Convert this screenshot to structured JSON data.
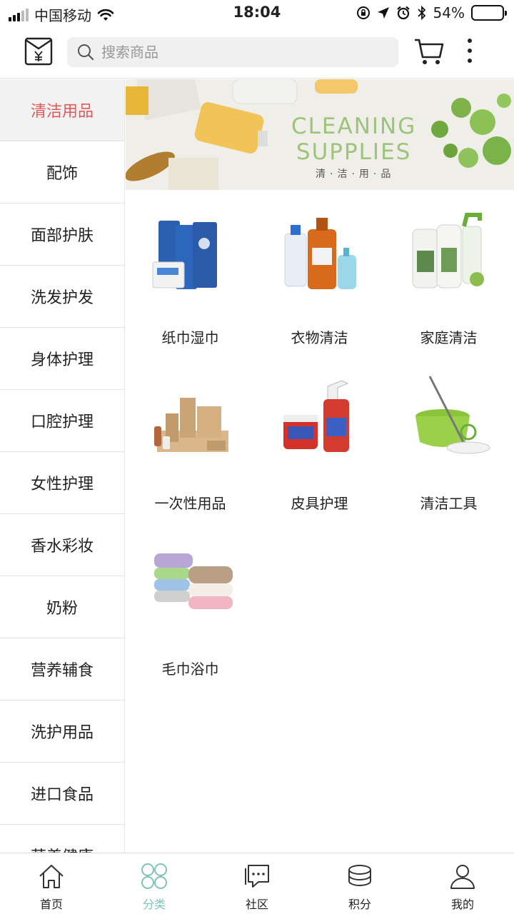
{
  "status_bar": {
    "carrier": "中国移动",
    "time": "18:04",
    "battery": "54%",
    "battery_level": 0.54
  },
  "header": {
    "search_placeholder": "搜索商品"
  },
  "sidebar": {
    "items": [
      {
        "label": "清洁用品",
        "active": true
      },
      {
        "label": "配饰"
      },
      {
        "label": "面部护肤"
      },
      {
        "label": "洗发护发"
      },
      {
        "label": "身体护理"
      },
      {
        "label": "口腔护理"
      },
      {
        "label": "女性护理"
      },
      {
        "label": "香水彩妆"
      },
      {
        "label": "奶粉"
      },
      {
        "label": "营养辅食"
      },
      {
        "label": "洗护用品"
      },
      {
        "label": "进口食品"
      },
      {
        "label": "营养健康"
      }
    ]
  },
  "banner": {
    "title_line1": "CLEANING",
    "title_line2": "SUPPLIES",
    "subtitle": "清·洁·用·品"
  },
  "categories": [
    {
      "label": "纸巾湿巾",
      "icon": "tissue-packs-icon"
    },
    {
      "label": "衣物清洁",
      "icon": "laundry-detergent-icon"
    },
    {
      "label": "家庭清洁",
      "icon": "household-cleaner-icon"
    },
    {
      "label": "一次性用品",
      "icon": "disposable-kit-icon"
    },
    {
      "label": "皮具护理",
      "icon": "leather-care-icon"
    },
    {
      "label": "清洁工具",
      "icon": "mop-bucket-icon"
    },
    {
      "label": "毛巾浴巾",
      "icon": "towel-stack-icon"
    }
  ],
  "tabbar": {
    "items": [
      {
        "label": "首页",
        "icon": "home-icon"
      },
      {
        "label": "分类",
        "icon": "category-grid-icon",
        "active": true
      },
      {
        "label": "社区",
        "icon": "chat-bubble-icon"
      },
      {
        "label": "积分",
        "icon": "coins-stack-icon"
      },
      {
        "label": "我的",
        "icon": "user-icon"
      }
    ]
  },
  "colors": {
    "active_sidebar_text": "#e05a5a",
    "active_tab": "#7fc4b8",
    "banner_text": "#9cc47a"
  }
}
